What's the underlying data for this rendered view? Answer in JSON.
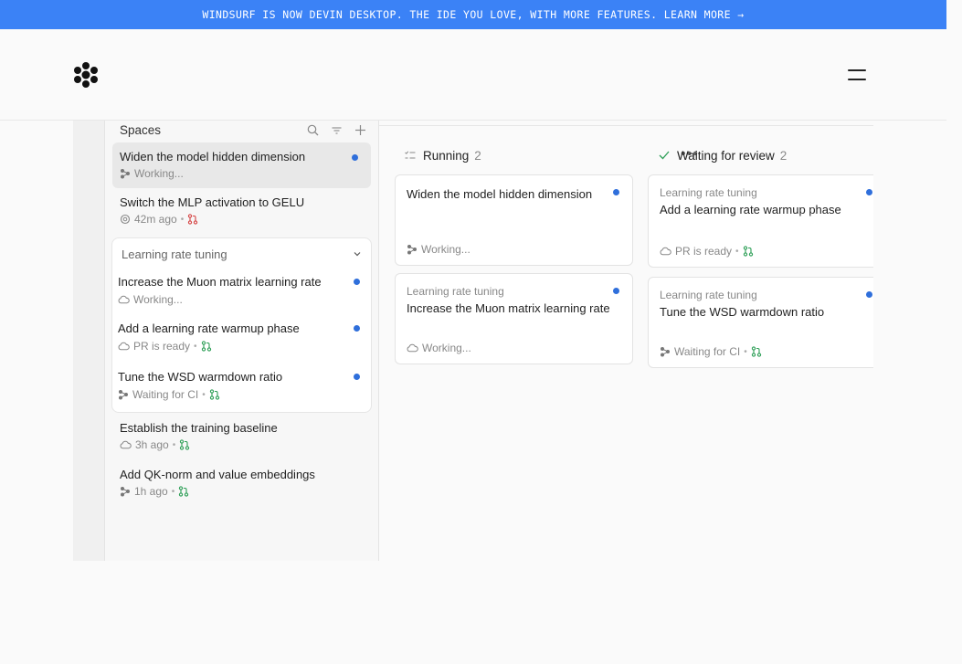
{
  "banner": {
    "text": "WINDSURF IS NOW DEVIN DESKTOP. THE IDE YOU LOVE, WITH MORE FEATURES. LEARN MORE →"
  },
  "colors": {
    "banner": "#3b82f6",
    "dot_blue": "#2f6fdb",
    "pr_green": "#2e9f57",
    "pr_red": "#d64545"
  },
  "sidebar": {
    "title": "Spaces",
    "items_top": [
      {
        "title": "Widen the model hidden dimension",
        "status": "Working...",
        "icon": "agent-icon",
        "active": true,
        "unread": true
      },
      {
        "title": "Switch the MLP activation to GELU",
        "status": "42m ago",
        "icon": "openai-icon",
        "pr": "pr-closed-icon"
      }
    ],
    "group": {
      "title": "Learning rate tuning",
      "items": [
        {
          "title": "Increase the Muon matrix learning rate",
          "status": "Working...",
          "icon": "cloud-icon",
          "unread": true
        },
        {
          "title": "Add a learning rate warmup phase",
          "status": "PR is ready",
          "icon": "cloud-icon",
          "pr": "pr-open-icon",
          "unread": true
        },
        {
          "title": "Tune the WSD warmdown ratio",
          "status": "Waiting for CI",
          "icon": "agent-icon",
          "pr": "pr-open-icon",
          "unread": true
        }
      ]
    },
    "items_bottom": [
      {
        "title": "Establish the training baseline",
        "status": "3h ago",
        "icon": "cloud-icon",
        "pr": "pr-open-icon"
      },
      {
        "title": "Add QK-norm and value embeddings",
        "status": "1h ago",
        "icon": "agent-icon",
        "pr": "pr-open-icon"
      }
    ]
  },
  "board": {
    "columns": [
      {
        "name": "Running",
        "count": "2",
        "icon": "checklist-icon",
        "cards": [
          {
            "category": "",
            "title": "Widen the model hidden dimension",
            "status": "Working...",
            "icon": "agent-icon"
          },
          {
            "category": "Learning rate tuning",
            "title": "Increase the Muon matrix learning rate",
            "status": "Working...",
            "icon": "cloud-icon"
          }
        ]
      },
      {
        "name": "Waiting for review",
        "count": "2",
        "icon": "check-icon",
        "cards": [
          {
            "category": "Learning rate tuning",
            "title": "Add a learning rate warmup phase",
            "status": "PR is ready",
            "icon": "cloud-icon",
            "pr": "pr-open-icon"
          },
          {
            "category": "Learning rate tuning",
            "title": "Tune the WSD warmdown ratio",
            "status": "Waiting for CI",
            "icon": "agent-icon",
            "pr": "pr-open-icon"
          }
        ]
      }
    ]
  }
}
